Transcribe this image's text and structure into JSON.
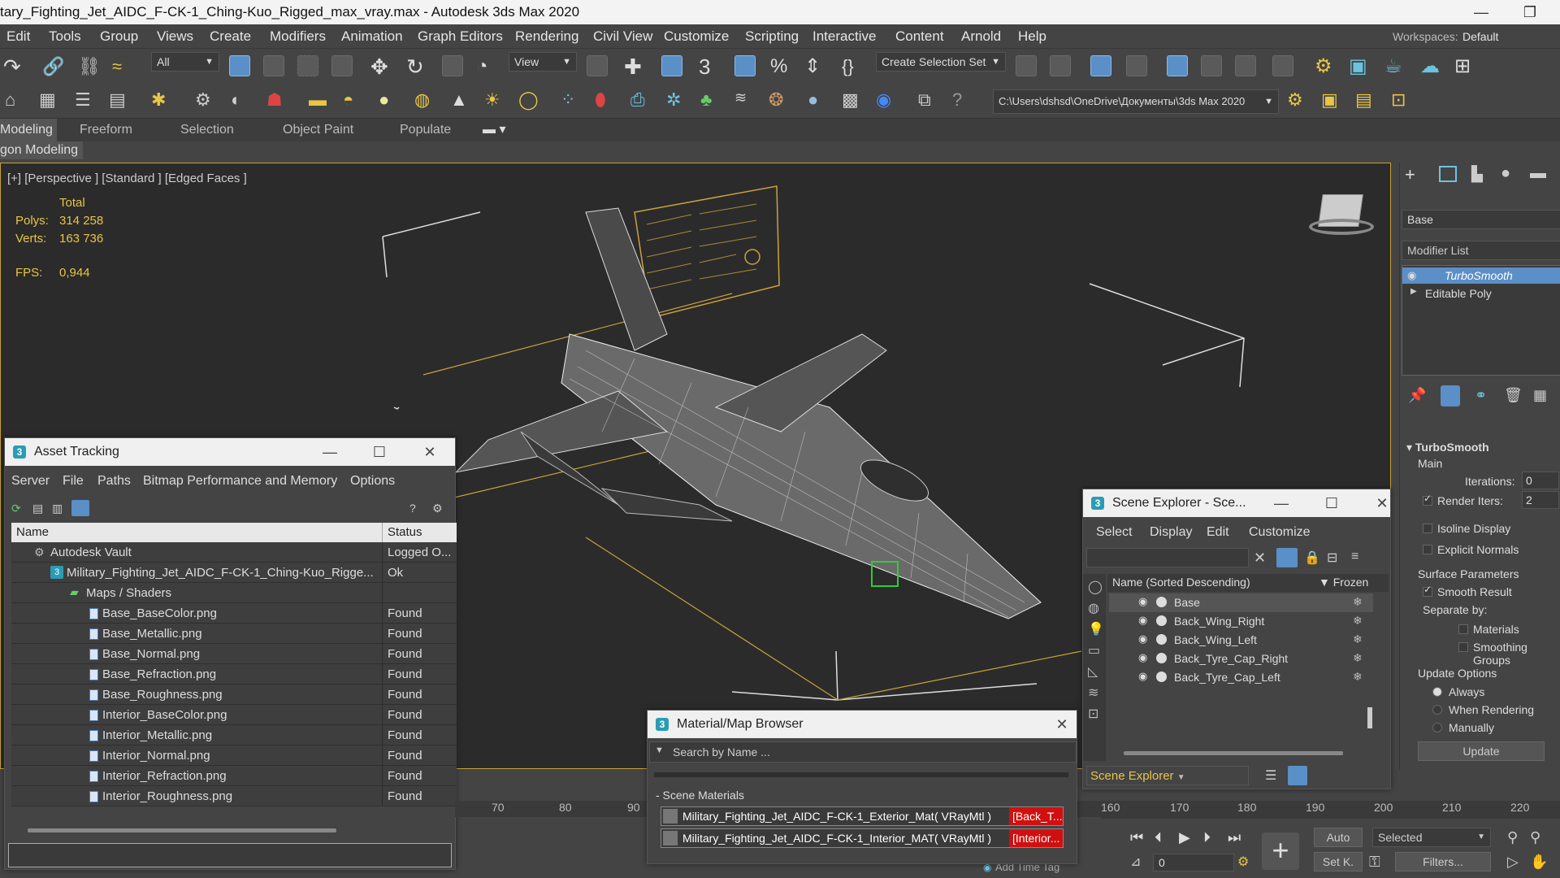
{
  "window": {
    "title": "tary_Fighting_Jet_AIDC_F-CK-1_Ching-Kuo_Rigged_max_vray.max - Autodesk 3ds Max 2020",
    "minimize": "—",
    "maximize": "❐"
  },
  "menubar": {
    "items": [
      "Edit",
      "Tools",
      "Group",
      "Views",
      "Create",
      "Modifiers",
      "Animation",
      "Graph Editors",
      "Rendering",
      "Civil View",
      "Customize",
      "Scripting",
      "Interactive",
      "Content",
      "Arnold",
      "Help"
    ],
    "workspaces_label": "Workspaces:",
    "workspaces_value": "Default"
  },
  "toolbar": {
    "filter_value": "All",
    "view_value": "View",
    "selection_set_placeholder": "Create Selection Set",
    "project_path": "C:\\Users\\dshsd\\OneDrive\\Документы\\3ds Max 2020"
  },
  "ribbon": {
    "tabs": [
      "Modeling",
      "Freeform",
      "Selection",
      "Object Paint",
      "Populate"
    ],
    "sub_label": "gon Modeling"
  },
  "viewport": {
    "label": "[+] [Perspective ] [Standard ] [Edged Faces ]",
    "stats": {
      "total_label": "Total",
      "polys_label": "Polys:",
      "polys_value": "314 258",
      "verts_label": "Verts:",
      "verts_value": "163 736",
      "fps_label": "FPS:",
      "fps_value": "0,944"
    }
  },
  "command_panel": {
    "object_name": "Base",
    "modifier_list_label": "Modifier List",
    "stack": [
      "TurboSmooth",
      "Editable Poly"
    ],
    "rollout_title": "TurboSmooth",
    "main_label": "Main",
    "iterations_label": "Iterations:",
    "iterations_value": "0",
    "render_iters_label": "Render Iters:",
    "render_iters_value": "2",
    "isoline_label": "Isoline Display",
    "explicit_normals_label": "Explicit Normals",
    "surface_params_label": "Surface Parameters",
    "smooth_result_label": "Smooth Result",
    "separate_by_label": "Separate by:",
    "materials_label": "Materials",
    "smoothing_groups_label": "Smoothing Groups",
    "update_options_label": "Update Options",
    "always_label": "Always",
    "when_rendering_label": "When Rendering",
    "manually_label": "Manually",
    "update_button": "Update"
  },
  "asset_tracking": {
    "title": "Asset Tracking",
    "menu": [
      "Server",
      "File",
      "Paths",
      "Bitmap Performance and Memory",
      "Options"
    ],
    "col_name": "Name",
    "col_status": "Status",
    "rows": [
      {
        "name": "Autodesk Vault",
        "status": "Logged O..."
      },
      {
        "name": "Military_Fighting_Jet_AIDC_F-CK-1_Ching-Kuo_Rigge...",
        "status": "Ok"
      },
      {
        "name": "Maps / Shaders",
        "status": ""
      },
      {
        "name": "Base_BaseColor.png",
        "status": "Found"
      },
      {
        "name": "Base_Metallic.png",
        "status": "Found"
      },
      {
        "name": "Base_Normal.png",
        "status": "Found"
      },
      {
        "name": "Base_Refraction.png",
        "status": "Found"
      },
      {
        "name": "Base_Roughness.png",
        "status": "Found"
      },
      {
        "name": "Interior_BaseColor.png",
        "status": "Found"
      },
      {
        "name": "Interior_Metallic.png",
        "status": "Found"
      },
      {
        "name": "Interior_Normal.png",
        "status": "Found"
      },
      {
        "name": "Interior_Refraction.png",
        "status": "Found"
      },
      {
        "name": "Interior_Roughness.png",
        "status": "Found"
      }
    ]
  },
  "scene_explorer": {
    "title": "Scene Explorer - Sce...",
    "menu": [
      "Select",
      "Display",
      "Edit",
      "Customize"
    ],
    "col_name": "Name (Sorted Descending)",
    "col_frozen": "Frozen",
    "rows": [
      "Base",
      "Back_Wing_Right",
      "Back_Wing_Left",
      "Back_Tyre_Cap_Right",
      "Back_Tyre_Cap_Left"
    ],
    "footer_dropdown": "Scene Explorer"
  },
  "material_browser": {
    "title": "Material/Map Browser",
    "search_placeholder": "Search by Name ...",
    "section": "- Scene Materials",
    "materials": [
      {
        "name": "Military_Fighting_Jet_AIDC_F-CK-1_Exterior_Mat",
        "type": "( VRayMtl )",
        "tag": "[Back_T..."
      },
      {
        "name": "Military_Fighting_Jet_AIDC_F-CK-1_Interior_MAT",
        "type": "( VRayMtl )",
        "tag": "[Interior..."
      }
    ]
  },
  "timeline": {
    "ticks_left": [
      "70",
      "80",
      "90"
    ],
    "ticks_right": [
      "160",
      "170",
      "180",
      "190",
      "200",
      "210",
      "220"
    ],
    "add_time_tag": "Add Time Tag"
  },
  "bottom": {
    "auto_label": "Auto",
    "setkey_label": "Set K.",
    "selected_value": "Selected",
    "filters_label": "Filters...",
    "frame_value": "0"
  },
  "colors": {
    "accent": "#5b8fc7",
    "viewport_border": "#c8a23b",
    "stat_text": "#e8c545",
    "material_tag_red": "#d01010"
  }
}
